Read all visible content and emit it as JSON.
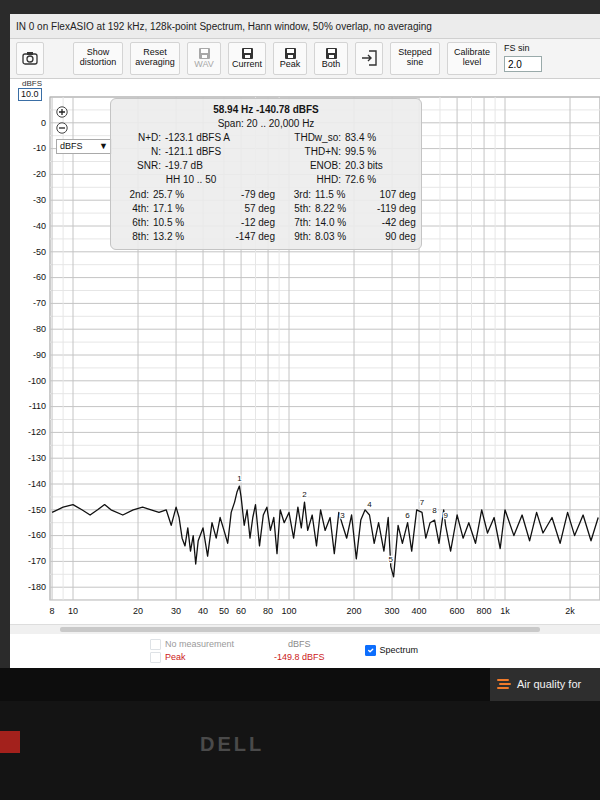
{
  "window": {
    "title": "IN 0 on FlexASIO at 192 kHz, 128k-point Spectrum, Hann window, 50% overlap, no averaging"
  },
  "toolbar": [
    {
      "kind": "snapshot",
      "disabled": false
    },
    {
      "kind": "text",
      "label": "Show distortion",
      "disabled": false
    },
    {
      "kind": "text",
      "label": "Reset averaging",
      "disabled": false
    },
    {
      "kind": "save",
      "label": "WAV",
      "disabled": true
    },
    {
      "kind": "save",
      "label": "Current",
      "disabled": false
    },
    {
      "kind": "save",
      "label": "Peak",
      "disabled": false
    },
    {
      "kind": "save",
      "label": "Both",
      "disabled": false
    },
    {
      "kind": "import",
      "disabled": false
    },
    {
      "kind": "text",
      "label": "Stepped sine",
      "disabled": false
    },
    {
      "kind": "text",
      "label": "Calibrate level",
      "disabled": false
    },
    {
      "kind": "field",
      "label": "FS sin",
      "value": "2.0",
      "disabled": false
    }
  ],
  "axis": {
    "y_unit": "dBFS",
    "y_max": "10.0",
    "y_ticks": [
      {
        "label": "0",
        "value": 0
      },
      {
        "label": "-10",
        "value": -10
      },
      {
        "label": "-20",
        "value": -20
      },
      {
        "label": "-30",
        "value": -30
      },
      {
        "label": "-40",
        "value": -40
      },
      {
        "label": "-50",
        "value": -50
      },
      {
        "label": "-60",
        "value": -60
      },
      {
        "label": "-70",
        "value": -70
      },
      {
        "label": "-80",
        "value": -80
      },
      {
        "label": "-90",
        "value": -90
      },
      {
        "label": "-100",
        "value": -100
      },
      {
        "label": "-110",
        "value": -110
      },
      {
        "label": "-120",
        "value": -120
      },
      {
        "label": "-130",
        "value": -130
      },
      {
        "label": "-140",
        "value": -140
      },
      {
        "label": "-150",
        "value": -150
      },
      {
        "label": "-160",
        "value": -160
      },
      {
        "label": "-170",
        "value": -170
      },
      {
        "label": "-180",
        "value": -180
      }
    ],
    "x_ticks": [
      {
        "label": "8",
        "value": 8
      },
      {
        "label": "10",
        "value": 10
      },
      {
        "label": "20",
        "value": 20
      },
      {
        "label": "30",
        "value": 30
      },
      {
        "label": "40",
        "value": 40
      },
      {
        "label": "50",
        "value": 50
      },
      {
        "label": "60",
        "value": 60
      },
      {
        "label": "80",
        "value": 80
      },
      {
        "label": "100",
        "value": 100
      },
      {
        "label": "200",
        "value": 200
      },
      {
        "label": "300",
        "value": 300
      },
      {
        "label": "400",
        "value": 400
      },
      {
        "label": "600",
        "value": 600
      },
      {
        "label": "800",
        "value": 800
      },
      {
        "label": "1k",
        "value": 1000
      },
      {
        "label": "2k",
        "value": 2000
      }
    ]
  },
  "unit_select": {
    "value": "dBFS",
    "arrow": "▼"
  },
  "readout": {
    "cursor": "58.94 Hz -140.78 dBFS",
    "span": "Span: 20 .. 20,000 Hz",
    "left": [
      {
        "label": "N+D:",
        "value": "-123.1 dBFS A"
      },
      {
        "label": "N:",
        "value": "-121.1 dBFS"
      },
      {
        "label": "SNR:",
        "value": "-19.7 dB"
      }
    ],
    "range": "HH 10 .. 50",
    "right": [
      {
        "label": "THDw_so:",
        "value": "83.4 %"
      },
      {
        "label": "THD+N:",
        "value": "99.5 %"
      },
      {
        "label": "ENOB:",
        "value": "20.3 bits"
      },
      {
        "label": "HHD:",
        "value": "72.6 %"
      }
    ],
    "harmonics": [
      {
        "label": "2nd:",
        "value": "25.7 %",
        "phase": "-79 deg"
      },
      {
        "label": "3rd:",
        "value": "11.5 %",
        "phase": "107 deg"
      },
      {
        "label": "4th:",
        "value": "17.1 %",
        "phase": "57 deg"
      },
      {
        "label": "5th:",
        "value": "8.22 %",
        "phase": "-119 deg"
      },
      {
        "label": "6th:",
        "value": "10.5 %",
        "phase": "-12 deg"
      },
      {
        "label": "7th:",
        "value": "14.0 %",
        "phase": "-42 deg"
      },
      {
        "label": "8th:",
        "value": "13.2 %",
        "phase": "-147 deg"
      },
      {
        "label": "9th:",
        "value": "8.03 %",
        "phase": "90 deg"
      }
    ]
  },
  "series": [
    {
      "name": "Spectrum",
      "points": [
        [
          8,
          -151
        ],
        [
          9,
          -149
        ],
        [
          10,
          -148
        ],
        [
          11,
          -150
        ],
        [
          12,
          -152
        ],
        [
          13,
          -150
        ],
        [
          14,
          -148
        ],
        [
          15,
          -150
        ],
        [
          17,
          -152
        ],
        [
          19,
          -150
        ],
        [
          21,
          -149
        ],
        [
          23,
          -150
        ],
        [
          25,
          -151
        ],
        [
          27,
          -150
        ],
        [
          28.5,
          -156
        ],
        [
          30,
          -149
        ],
        [
          31,
          -153
        ],
        [
          32,
          -161
        ],
        [
          33,
          -164
        ],
        [
          34,
          -157
        ],
        [
          35,
          -166
        ],
        [
          36,
          -160
        ],
        [
          37,
          -171
        ],
        [
          38,
          -162
        ],
        [
          40,
          -157
        ],
        [
          42,
          -168
        ],
        [
          44,
          -155
        ],
        [
          46,
          -161
        ],
        [
          48,
          -153
        ],
        [
          50,
          -158
        ],
        [
          52,
          -163
        ],
        [
          54,
          -151
        ],
        [
          56,
          -147
        ],
        [
          57.5,
          -143
        ],
        [
          58.94,
          -140.8
        ],
        [
          60,
          -145
        ],
        [
          62,
          -156
        ],
        [
          64,
          -150
        ],
        [
          66,
          -161
        ],
        [
          68,
          -153
        ],
        [
          70,
          -148
        ],
        [
          73,
          -164
        ],
        [
          76,
          -152
        ],
        [
          79,
          -149
        ],
        [
          82,
          -158
        ],
        [
          85,
          -153
        ],
        [
          88,
          -167
        ],
        [
          91,
          -150
        ],
        [
          95,
          -155
        ],
        [
          100,
          -151
        ],
        [
          105,
          -161
        ],
        [
          110,
          -149
        ],
        [
          114,
          -157
        ],
        [
          118,
          -147
        ],
        [
          122,
          -158
        ],
        [
          128,
          -152
        ],
        [
          134,
          -164
        ],
        [
          140,
          -150
        ],
        [
          147,
          -158
        ],
        [
          155,
          -153
        ],
        [
          162,
          -167
        ],
        [
          170,
          -151
        ],
        [
          177,
          -156
        ],
        [
          185,
          -161
        ],
        [
          195,
          -152
        ],
        [
          205,
          -169
        ],
        [
          215,
          -154
        ],
        [
          225,
          -150
        ],
        [
          236,
          -152
        ],
        [
          248,
          -163
        ],
        [
          260,
          -155
        ],
        [
          275,
          -166
        ],
        [
          288,
          -153
        ],
        [
          296,
          -172
        ],
        [
          305,
          -176
        ],
        [
          320,
          -156
        ],
        [
          335,
          -163
        ],
        [
          354,
          -155
        ],
        [
          370,
          -166
        ],
        [
          390,
          -150
        ],
        [
          413,
          -151
        ],
        [
          430,
          -161
        ],
        [
          450,
          -155
        ],
        [
          472,
          -154
        ],
        [
          495,
          -163
        ],
        [
          520,
          -150
        ],
        [
          531,
          -156
        ],
        [
          560,
          -166
        ],
        [
          600,
          -152
        ],
        [
          640,
          -161
        ],
        [
          680,
          -155
        ],
        [
          730,
          -163
        ],
        [
          780,
          -150
        ],
        [
          830,
          -159
        ],
        [
          890,
          -153
        ],
        [
          950,
          -165
        ],
        [
          1000,
          -150
        ],
        [
          1100,
          -160
        ],
        [
          1200,
          -152
        ],
        [
          1300,
          -162
        ],
        [
          1400,
          -151
        ],
        [
          1500,
          -159
        ],
        [
          1650,
          -153
        ],
        [
          1800,
          -163
        ],
        [
          1950,
          -151
        ],
        [
          2100,
          -160
        ],
        [
          2300,
          -152
        ],
        [
          2500,
          -162
        ],
        [
          2700,
          -153
        ]
      ]
    }
  ],
  "markers": [
    {
      "label": "1",
      "freq_hz": 58.94,
      "db": -140.8
    },
    {
      "label": "2",
      "freq_hz": 118,
      "db": -147
    },
    {
      "label": "3",
      "freq_hz": 177,
      "db": -155
    },
    {
      "label": "4",
      "freq_hz": 236,
      "db": -151
    },
    {
      "label": "5",
      "freq_hz": 296,
      "db": -172
    },
    {
      "label": "6",
      "freq_hz": 354,
      "db": -155
    },
    {
      "label": "7",
      "freq_hz": 413,
      "db": -150
    },
    {
      "label": "8",
      "freq_hz": 472,
      "db": -153
    },
    {
      "label": "9",
      "freq_hz": 531,
      "db": -155
    }
  ],
  "legend": {
    "items": [
      {
        "label": "No measurement",
        "checked": false,
        "color": "#9a9a9a"
      },
      {
        "label": "Peak",
        "checked": false,
        "color": "#cc2020"
      },
      {
        "label": "Spectrum",
        "checked": true,
        "color": "#111111"
      }
    ],
    "unit": "dBFS",
    "reading": "-149.8 dBFS"
  },
  "taskbar": {
    "label": "Air quality for"
  },
  "bezel": {
    "logo": "DELL"
  }
}
